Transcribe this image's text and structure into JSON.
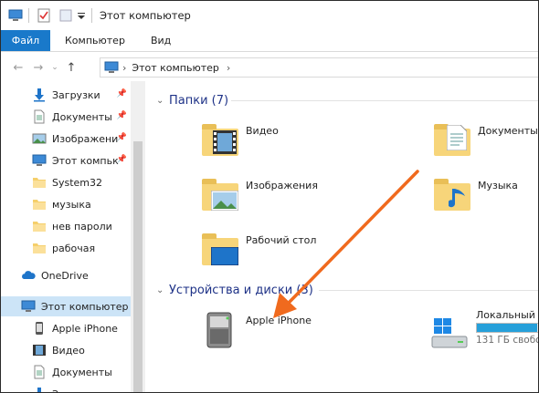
{
  "window": {
    "title": "Этот компьютер"
  },
  "ribbon": {
    "tabs": [
      "Файл",
      "Компьютер",
      "Вид"
    ]
  },
  "address": {
    "path": "Этот компьютер"
  },
  "nav": {
    "items": [
      {
        "label": "Загрузки",
        "icon": "download-icon",
        "pinned": true
      },
      {
        "label": "Документы",
        "icon": "documents-icon",
        "pinned": true
      },
      {
        "label": "Изображени",
        "icon": "pictures-icon",
        "pinned": true
      },
      {
        "label": "Этот компьк",
        "icon": "computer-icon",
        "pinned": true
      },
      {
        "label": "System32",
        "icon": "folder-icon",
        "pinned": false
      },
      {
        "label": "музыка",
        "icon": "folder-icon",
        "pinned": false
      },
      {
        "label": "нев пароли",
        "icon": "folder-icon",
        "pinned": false
      },
      {
        "label": "рабочая",
        "icon": "folder-icon",
        "pinned": false
      },
      {
        "label": "OneDrive",
        "icon": "onedrive-icon",
        "pinned": false
      },
      {
        "label": "Этот компьютер",
        "icon": "computer-icon",
        "pinned": false
      },
      {
        "label": "Apple iPhone",
        "icon": "phone-icon",
        "pinned": false
      },
      {
        "label": "Видео",
        "icon": "video-icon",
        "pinned": false
      },
      {
        "label": "Документы",
        "icon": "documents-icon",
        "pinned": false
      },
      {
        "label": "Загрузки",
        "icon": "download-icon",
        "pinned": false
      }
    ]
  },
  "folders_group": {
    "title": "Папки (7)",
    "items": [
      {
        "label": "Видео",
        "icon": "video-folder-icon"
      },
      {
        "label": "Документы",
        "icon": "documents-folder-icon"
      },
      {
        "label": "Изображения",
        "icon": "pictures-folder-icon"
      },
      {
        "label": "Музыка",
        "icon": "music-folder-icon"
      },
      {
        "label": "Рабочий стол",
        "icon": "desktop-folder-icon"
      }
    ]
  },
  "devices_group": {
    "title": "Устройства и диски (3)",
    "items": [
      {
        "label": "Apple iPhone",
        "icon": "iphone-device-icon"
      },
      {
        "label": "Локальный",
        "sub": "131 ГБ свобо",
        "icon": "local-disk-icon",
        "used_fraction": 0.85
      }
    ]
  },
  "colors": {
    "accent": "#1979ca",
    "selection": "#cce4f7",
    "group_title": "#1e3287",
    "arrow": "#f06a1e"
  }
}
